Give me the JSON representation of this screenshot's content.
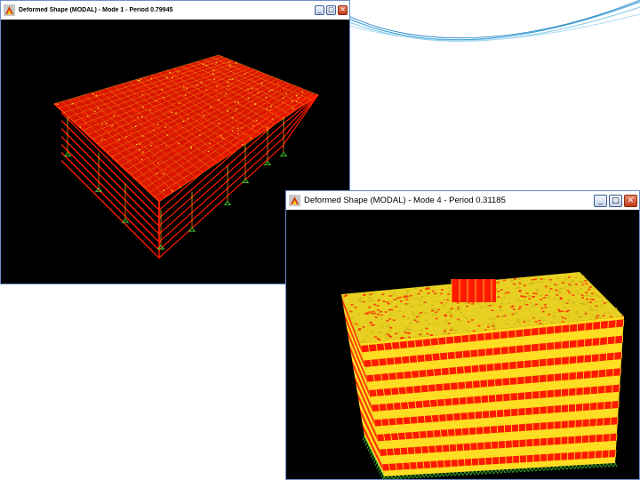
{
  "windows": [
    {
      "title": "Deformed Shape (MODAL) - Mode 1 - Period 0.79945",
      "controls": {
        "minimize": "_",
        "maximize": "□",
        "close": "✕"
      }
    },
    {
      "title": "Deformed Shape (MODAL) - Mode 4 - Period 0.31185",
      "controls": {
        "minimize": "_",
        "maximize": "□",
        "close": "✕"
      }
    }
  ],
  "colors": {
    "structure_red": "#ff1a00",
    "mesh_yellow": "#ffdd22",
    "support_green": "#44cc33",
    "viewport_bg": "#000000",
    "accent_blue": "#3aa0d8"
  }
}
